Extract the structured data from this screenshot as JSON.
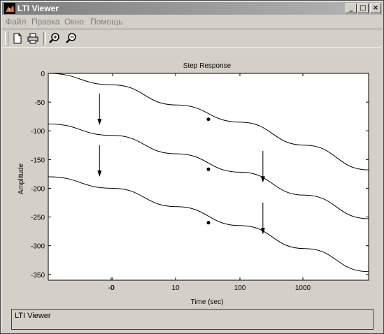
{
  "window": {
    "title": "LTI Viewer"
  },
  "title_buttons": {
    "minimize": "_",
    "maximize": "□",
    "close": "×"
  },
  "menu": [
    "Файл",
    "Правка",
    "Окно",
    "Помощь"
  ],
  "toolbar": {
    "icons": [
      "new-file-icon",
      "print-icon",
      "zoom-in-icon",
      "zoom-out-icon"
    ]
  },
  "chart_data": {
    "type": "line",
    "title": "Step Response",
    "xlabel": "Time (sec)",
    "ylabel": "Amplitude",
    "x_ticks": [
      "-0",
      "0",
      "10",
      "100",
      "1000"
    ],
    "y_ticks": [
      "0",
      "-50",
      "-100",
      "-150",
      "-200",
      "-250",
      "-300",
      "-350"
    ],
    "ylim": [
      -360,
      0
    ],
    "series": [
      {
        "values": [
          [
            0,
            0
          ],
          [
            100,
            -20
          ],
          [
            200,
            -55
          ],
          [
            300,
            -85
          ],
          [
            400,
            -125
          ],
          [
            500,
            -168
          ]
        ],
        "marker": [
          250,
          -80
        ]
      },
      {
        "values": [
          [
            0,
            -88
          ],
          [
            100,
            -108
          ],
          [
            200,
            -140
          ],
          [
            300,
            -172
          ],
          [
            400,
            -212
          ],
          [
            500,
            -253
          ]
        ],
        "marker": [
          250,
          -167
        ]
      },
      {
        "values": [
          [
            0,
            -180
          ],
          [
            100,
            -200
          ],
          [
            200,
            -232
          ],
          [
            300,
            -265
          ],
          [
            400,
            -305
          ],
          [
            500,
            -345
          ]
        ],
        "marker": [
          250,
          -260
        ]
      }
    ],
    "arrows": [
      {
        "x": 80,
        "y_from": -35,
        "y_to": -90
      },
      {
        "x": 80,
        "y_from": -125,
        "y_to": -180
      },
      {
        "x": 335,
        "y_from": -135,
        "y_to": -190
      },
      {
        "x": 335,
        "y_from": -225,
        "y_to": -280
      }
    ]
  },
  "status": {
    "text": "LTI Viewer"
  },
  "colors": {
    "titlebar": "#7d7d7d",
    "face": "#d4d0c8",
    "plot_bg": "#ffffff"
  }
}
